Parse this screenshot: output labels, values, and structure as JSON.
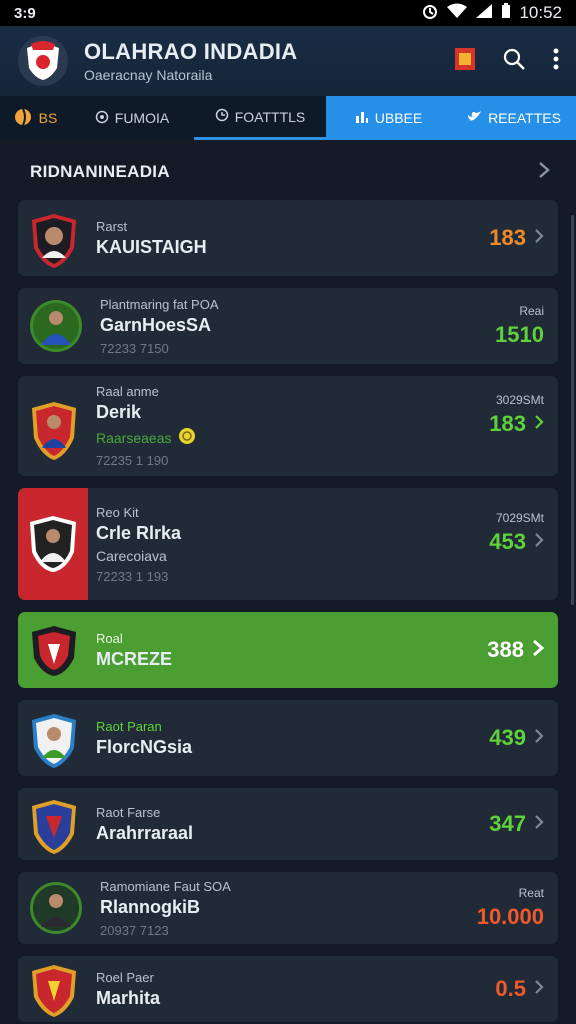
{
  "status_bar": {
    "left_time": "3:9",
    "clock": "10:52"
  },
  "app": {
    "title": "OLAHRAO INDADIA",
    "subtitle": "Oaeracnay Natoraila"
  },
  "tabs": [
    {
      "label": "BS",
      "icon": "ball-icon"
    },
    {
      "label": "FUMOIA",
      "icon": "globe-icon"
    },
    {
      "label": "FOATTTLS",
      "icon": "clock-icon"
    },
    {
      "label": "UBBEE",
      "icon": "chart-icon"
    },
    {
      "label": "REEATTES",
      "icon": "bird-icon"
    }
  ],
  "section": {
    "title": "RIDNANINEADIA"
  },
  "rows": [
    {
      "label": "Rarst",
      "name": "KAUISTAIGH",
      "score": "183",
      "score_color": "#f08a2a"
    },
    {
      "label": "Plantmaring fat POA",
      "name": "GarnHoesSA",
      "meta": "72233 7150",
      "right_label": "Reai",
      "score": "1510",
      "score_color": "#5fd13a"
    },
    {
      "label": "Raal anme",
      "name": "Derik",
      "sub": "Raarseaeas",
      "meta": "72235 1 190",
      "right_label": "3029SMt",
      "score": "183",
      "score_color": "#5fd13a"
    },
    {
      "label": "Reo Kit",
      "name": "Crle Rlrka",
      "sub": "Carecoiava",
      "meta": "72233 1 193",
      "right_label": "7029SMt",
      "score": "453",
      "score_color": "#5fd13a"
    },
    {
      "label": "Roal",
      "name": "MCREZE",
      "score": "388",
      "score_color": "#ffffff"
    },
    {
      "label": "Raot Paran",
      "name": "FlorcNGsia",
      "score": "439",
      "score_color": "#5fd13a"
    },
    {
      "label": "Raot Farse",
      "name": "Arahrraraal",
      "score": "347",
      "score_color": "#5fd13a"
    },
    {
      "label": "Ramomiane Faut SOA",
      "name": "RlannogkiB",
      "meta": "20937 7123",
      "right_label": "Reat",
      "score": "10.000",
      "score_color": "#f05a2a"
    },
    {
      "label": "Roel Paer",
      "name": "Marhita",
      "score": "0.5",
      "score_color": "#f05a2a"
    }
  ]
}
